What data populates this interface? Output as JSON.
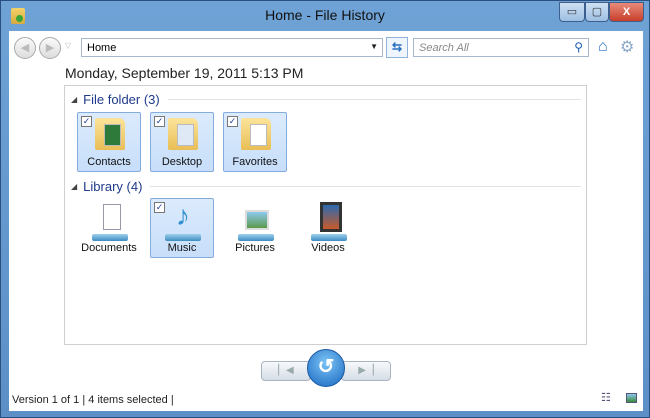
{
  "window": {
    "title": "Home - File History",
    "minimize": "▭",
    "maximize": "▢",
    "close": "X"
  },
  "toolbar": {
    "address": "Home",
    "search_placeholder": "Search All"
  },
  "date": "Monday, September 19, 2011 5:13 PM",
  "groups": [
    {
      "label": "File folder (3)",
      "items": [
        {
          "label": "Contacts",
          "selected": true
        },
        {
          "label": "Desktop",
          "selected": true
        },
        {
          "label": "Favorites",
          "selected": true
        }
      ]
    },
    {
      "label": "Library (4)",
      "items": [
        {
          "label": "Documents",
          "selected": false
        },
        {
          "label": "Music",
          "selected": true
        },
        {
          "label": "Pictures",
          "selected": false
        },
        {
          "label": "Videos",
          "selected": false
        }
      ]
    }
  ],
  "status": {
    "version": "Version 1 of 1",
    "separator": "|",
    "selected": "4 items selected"
  }
}
